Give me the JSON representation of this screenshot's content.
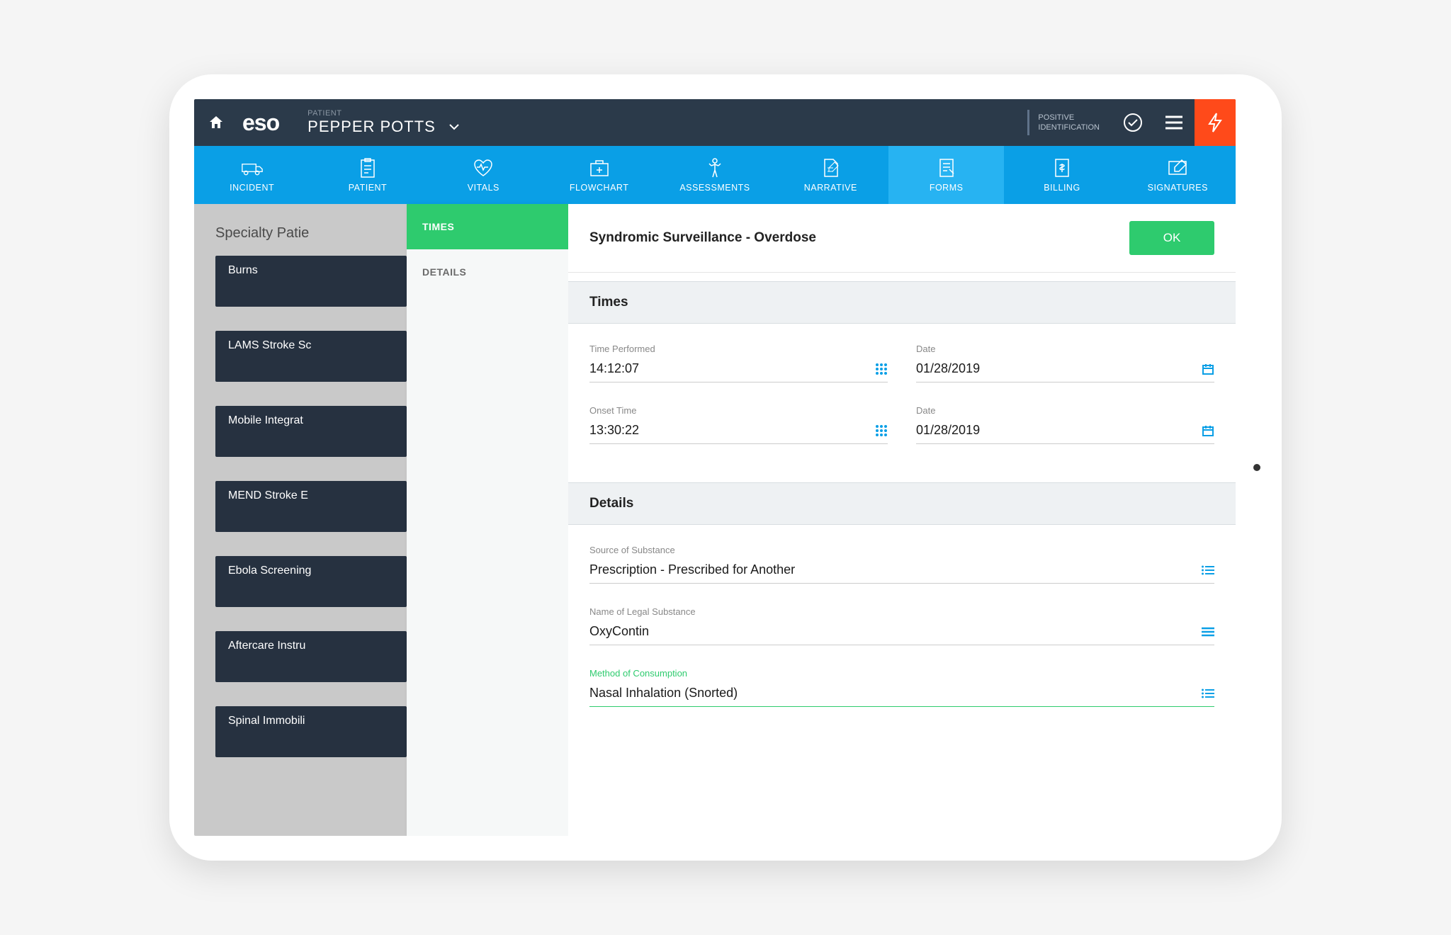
{
  "header": {
    "logo": "eso",
    "patient_label": "PATIENT",
    "patient_name": "PEPPER POTTS",
    "positive_id_line1": "POSITIVE",
    "positive_id_line2": "IDENTIFICATION"
  },
  "nav": [
    {
      "label": "INCIDENT"
    },
    {
      "label": "PATIENT"
    },
    {
      "label": "VITALS"
    },
    {
      "label": "FLOWCHART"
    },
    {
      "label": "ASSESSMENTS"
    },
    {
      "label": "NARRATIVE"
    },
    {
      "label": "FORMS",
      "active": true
    },
    {
      "label": "BILLING"
    },
    {
      "label": "SIGNATURES"
    }
  ],
  "left": {
    "title": "Specialty Patie",
    "cards": [
      "Burns",
      "LAMS Stroke Sc",
      "Mobile Integrat",
      "MEND Stroke E",
      "Ebola Screening",
      "Aftercare Instru",
      "Spinal Immobili"
    ]
  },
  "mid_tabs": [
    {
      "label": "TIMES",
      "active": true
    },
    {
      "label": "DETAILS"
    }
  ],
  "form": {
    "title": "Syndromic Surveillance - Overdose",
    "ok": "OK",
    "section_times": "Times",
    "section_details": "Details",
    "time_performed_label": "Time Performed",
    "time_performed_value": "14:12:07",
    "date1_label": "Date",
    "date1_value": "01/28/2019",
    "onset_label": "Onset Time",
    "onset_value": "13:30:22",
    "date2_label": "Date",
    "date2_value": "01/28/2019",
    "source_label": "Source of Substance",
    "source_value": "Prescription - Prescribed for Another",
    "legal_label": "Name of Legal Substance",
    "legal_value": "OxyContin",
    "method_label": "Method of Consumption",
    "method_value": "Nasal Inhalation (Snorted)"
  }
}
